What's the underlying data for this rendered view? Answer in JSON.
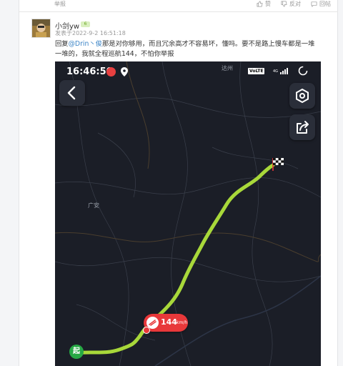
{
  "previous_post": {
    "report_label": "举报",
    "like_label": "赞",
    "dislike_label": "反对",
    "reply_label": "回帖"
  },
  "post": {
    "username": "小剑yw",
    "level": "6",
    "time": "发表于2022-9-2 16:51:18",
    "reply_prefix": "回复",
    "mention": "@Drin丶俊",
    "text": "那是对你够用，而且冗余高才不容易坏，懂吗。要不是路上慢车都是一堆一堆的，我就全程巡航144，不怕你举报"
  },
  "screenshot": {
    "status_time": "16:46:50",
    "volte": "VoLTE",
    "network": "4G",
    "city_labels": {
      "dazhou": "达州",
      "guangan": "广安"
    },
    "speed_value": "144",
    "speed_unit": "km/h",
    "start_label": "起",
    "icons": {
      "back": "back-arrow-icon",
      "settings": "settings-hexagon-icon",
      "share": "share-icon",
      "finish": "checkered-flag-icon",
      "speed": "speed-camera-icon",
      "location": "location-pin-icon"
    },
    "colors": {
      "route": "#a8d83a",
      "map_bg": "#1b1e27",
      "speed_bubble": "#e8383a",
      "start_marker": "#27a845",
      "mention": "#3c85c7"
    }
  }
}
